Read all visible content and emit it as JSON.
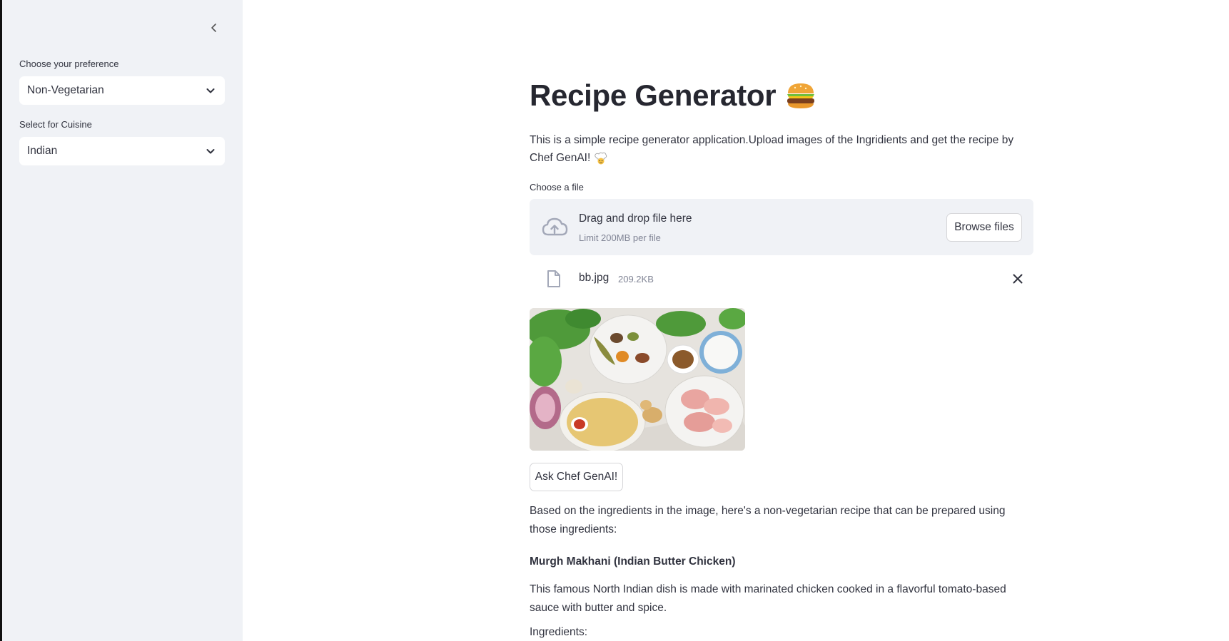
{
  "sidebar": {
    "collapse_icon": "chevron-left-icon",
    "preference": {
      "label": "Choose your preference",
      "value": "Non-Vegetarian"
    },
    "cuisine": {
      "label": "Select for Cuisine",
      "value": "Indian"
    }
  },
  "main": {
    "title": "Recipe Generator",
    "title_emoji": "hamburger-icon",
    "description": "This is a simple recipe generator application.Upload images of the Ingridients and get the recipe by Chef GenAI!",
    "description_emoji": "chef-icon",
    "uploader": {
      "label": "Choose a file",
      "drop_text": "Drag and drop file here",
      "limit_text": "Limit 200MB per file",
      "browse_label": "Browse files"
    },
    "file": {
      "name": "bb.jpg",
      "size": "209.2KB"
    },
    "ask_button": "Ask Chef GenAI!",
    "response": {
      "intro": "Based on the ingredients in the image, here's a non-vegetarian recipe that can be prepared using those ingredients:",
      "dish": "Murgh Makhani (Indian Butter Chicken)",
      "dish_desc": "This famous North Indian dish is made with marinated chicken cooked in a flavorful tomato-based sauce with butter and spice.",
      "ingredients_heading": "Ingredients:"
    }
  },
  "colors": {
    "sidebar_bg": "#f0f2f6",
    "dropzone_bg": "#f0f2f6",
    "text": "#31333f",
    "muted": "#808495"
  }
}
